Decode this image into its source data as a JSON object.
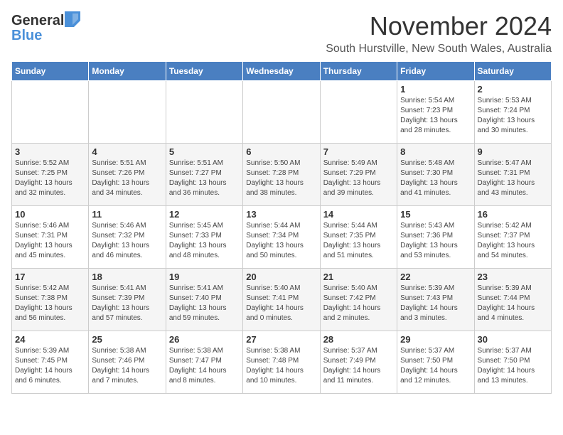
{
  "logo": {
    "general": "General",
    "blue": "Blue"
  },
  "header": {
    "month": "November 2024",
    "location": "South Hurstville, New South Wales, Australia"
  },
  "weekdays": [
    "Sunday",
    "Monday",
    "Tuesday",
    "Wednesday",
    "Thursday",
    "Friday",
    "Saturday"
  ],
  "weeks": [
    [
      {
        "day": "",
        "info": ""
      },
      {
        "day": "",
        "info": ""
      },
      {
        "day": "",
        "info": ""
      },
      {
        "day": "",
        "info": ""
      },
      {
        "day": "",
        "info": ""
      },
      {
        "day": "1",
        "info": "Sunrise: 5:54 AM\nSunset: 7:23 PM\nDaylight: 13 hours\nand 28 minutes."
      },
      {
        "day": "2",
        "info": "Sunrise: 5:53 AM\nSunset: 7:24 PM\nDaylight: 13 hours\nand 30 minutes."
      }
    ],
    [
      {
        "day": "3",
        "info": "Sunrise: 5:52 AM\nSunset: 7:25 PM\nDaylight: 13 hours\nand 32 minutes."
      },
      {
        "day": "4",
        "info": "Sunrise: 5:51 AM\nSunset: 7:26 PM\nDaylight: 13 hours\nand 34 minutes."
      },
      {
        "day": "5",
        "info": "Sunrise: 5:51 AM\nSunset: 7:27 PM\nDaylight: 13 hours\nand 36 minutes."
      },
      {
        "day": "6",
        "info": "Sunrise: 5:50 AM\nSunset: 7:28 PM\nDaylight: 13 hours\nand 38 minutes."
      },
      {
        "day": "7",
        "info": "Sunrise: 5:49 AM\nSunset: 7:29 PM\nDaylight: 13 hours\nand 39 minutes."
      },
      {
        "day": "8",
        "info": "Sunrise: 5:48 AM\nSunset: 7:30 PM\nDaylight: 13 hours\nand 41 minutes."
      },
      {
        "day": "9",
        "info": "Sunrise: 5:47 AM\nSunset: 7:31 PM\nDaylight: 13 hours\nand 43 minutes."
      }
    ],
    [
      {
        "day": "10",
        "info": "Sunrise: 5:46 AM\nSunset: 7:31 PM\nDaylight: 13 hours\nand 45 minutes."
      },
      {
        "day": "11",
        "info": "Sunrise: 5:46 AM\nSunset: 7:32 PM\nDaylight: 13 hours\nand 46 minutes."
      },
      {
        "day": "12",
        "info": "Sunrise: 5:45 AM\nSunset: 7:33 PM\nDaylight: 13 hours\nand 48 minutes."
      },
      {
        "day": "13",
        "info": "Sunrise: 5:44 AM\nSunset: 7:34 PM\nDaylight: 13 hours\nand 50 minutes."
      },
      {
        "day": "14",
        "info": "Sunrise: 5:44 AM\nSunset: 7:35 PM\nDaylight: 13 hours\nand 51 minutes."
      },
      {
        "day": "15",
        "info": "Sunrise: 5:43 AM\nSunset: 7:36 PM\nDaylight: 13 hours\nand 53 minutes."
      },
      {
        "day": "16",
        "info": "Sunrise: 5:42 AM\nSunset: 7:37 PM\nDaylight: 13 hours\nand 54 minutes."
      }
    ],
    [
      {
        "day": "17",
        "info": "Sunrise: 5:42 AM\nSunset: 7:38 PM\nDaylight: 13 hours\nand 56 minutes."
      },
      {
        "day": "18",
        "info": "Sunrise: 5:41 AM\nSunset: 7:39 PM\nDaylight: 13 hours\nand 57 minutes."
      },
      {
        "day": "19",
        "info": "Sunrise: 5:41 AM\nSunset: 7:40 PM\nDaylight: 13 hours\nand 59 minutes."
      },
      {
        "day": "20",
        "info": "Sunrise: 5:40 AM\nSunset: 7:41 PM\nDaylight: 14 hours\nand 0 minutes."
      },
      {
        "day": "21",
        "info": "Sunrise: 5:40 AM\nSunset: 7:42 PM\nDaylight: 14 hours\nand 2 minutes."
      },
      {
        "day": "22",
        "info": "Sunrise: 5:39 AM\nSunset: 7:43 PM\nDaylight: 14 hours\nand 3 minutes."
      },
      {
        "day": "23",
        "info": "Sunrise: 5:39 AM\nSunset: 7:44 PM\nDaylight: 14 hours\nand 4 minutes."
      }
    ],
    [
      {
        "day": "24",
        "info": "Sunrise: 5:39 AM\nSunset: 7:45 PM\nDaylight: 14 hours\nand 6 minutes."
      },
      {
        "day": "25",
        "info": "Sunrise: 5:38 AM\nSunset: 7:46 PM\nDaylight: 14 hours\nand 7 minutes."
      },
      {
        "day": "26",
        "info": "Sunrise: 5:38 AM\nSunset: 7:47 PM\nDaylight: 14 hours\nand 8 minutes."
      },
      {
        "day": "27",
        "info": "Sunrise: 5:38 AM\nSunset: 7:48 PM\nDaylight: 14 hours\nand 10 minutes."
      },
      {
        "day": "28",
        "info": "Sunrise: 5:37 AM\nSunset: 7:49 PM\nDaylight: 14 hours\nand 11 minutes."
      },
      {
        "day": "29",
        "info": "Sunrise: 5:37 AM\nSunset: 7:50 PM\nDaylight: 14 hours\nand 12 minutes."
      },
      {
        "day": "30",
        "info": "Sunrise: 5:37 AM\nSunset: 7:50 PM\nDaylight: 14 hours\nand 13 minutes."
      }
    ]
  ]
}
